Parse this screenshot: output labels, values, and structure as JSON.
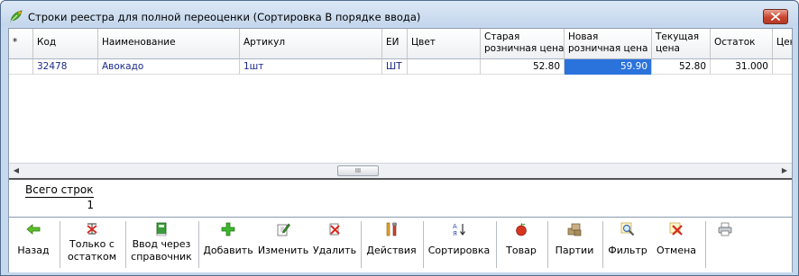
{
  "window": {
    "title": "Строки реестра для полной переоценки (Сортировка В порядке ввода)",
    "close_symbol": "✕"
  },
  "grid": {
    "columns": [
      {
        "key": "marker",
        "label": "*"
      },
      {
        "key": "code",
        "label": "Код"
      },
      {
        "key": "name",
        "label": "Наименование"
      },
      {
        "key": "article",
        "label": "Артикул"
      },
      {
        "key": "unit",
        "label": "ЕИ"
      },
      {
        "key": "color",
        "label": "Цвет"
      },
      {
        "key": "old_price",
        "label": "Старая розничная цена"
      },
      {
        "key": "new_price",
        "label": "Новая розничная цена"
      },
      {
        "key": "current_price",
        "label": "Текущая цена"
      },
      {
        "key": "stock",
        "label": "Остаток"
      },
      {
        "key": "price_cut",
        "label": "Цен"
      }
    ],
    "header_lines": {
      "old_price": [
        "Старая",
        "розничная цена"
      ],
      "new_price": [
        "Новая",
        "розничная цена"
      ],
      "current_price": [
        "Текущая",
        "цена"
      ]
    },
    "rows": [
      {
        "marker": "",
        "code": "32478",
        "name": "Авокадо",
        "article": "1шт",
        "unit": "ШТ",
        "color": "",
        "old_price": "52.80",
        "new_price": "59.90",
        "current_price": "52.80",
        "stock": "31.000"
      }
    ],
    "scroll_thumb_label": "III"
  },
  "totals": {
    "label": "Всего строк",
    "value": "1"
  },
  "toolbar": {
    "buttons": [
      {
        "id": "back",
        "label": "Назад",
        "icon": "arrow-left-icon"
      },
      {
        "id": "only-stock",
        "label_line1": "Только с",
        "label_line2": "остатком",
        "icon": "filter-off-icon"
      },
      {
        "id": "dict-input",
        "label_line1": "Ввод через",
        "label_line2": "справочник",
        "icon": "book-icon"
      },
      {
        "id": "add",
        "label": "Добавить",
        "icon": "plus-icon"
      },
      {
        "id": "edit",
        "label": "Изменить",
        "icon": "edit-icon"
      },
      {
        "id": "delete",
        "label": "Удалить",
        "icon": "delete-icon"
      },
      {
        "id": "actions",
        "label": "Действия",
        "icon": "tools-icon"
      },
      {
        "id": "sort",
        "label": "Сортировка",
        "icon": "sort-icon"
      },
      {
        "id": "goods",
        "label": "Товар",
        "icon": "apple-icon"
      },
      {
        "id": "batches",
        "label": "Партии",
        "icon": "boxes-icon"
      },
      {
        "id": "filter",
        "label": "Фильтр",
        "icon": "magnifier-icon"
      },
      {
        "id": "cancel",
        "label": "Отмена",
        "icon": "cancel-icon"
      },
      {
        "id": "print",
        "label": "",
        "icon": "printer-icon"
      }
    ]
  },
  "colors": {
    "selection": "#2a73dc",
    "code_text": "#1a2a8a",
    "title_bg": "#c4d6ec",
    "close_red": "#c8452f"
  }
}
